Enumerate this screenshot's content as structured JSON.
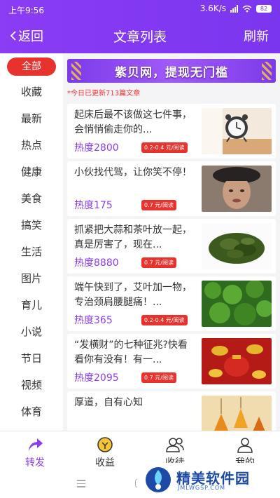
{
  "status_bar": {
    "time": "上午9:56",
    "speed": "3.6K/s",
    "battery": "82"
  },
  "header": {
    "back_label": "返回",
    "title": "文章列表",
    "refresh_label": "刷新"
  },
  "sidebar": {
    "items": [
      {
        "label": "全部",
        "active": true
      },
      {
        "label": "收藏"
      },
      {
        "label": "最新"
      },
      {
        "label": "热点"
      },
      {
        "label": "健康"
      },
      {
        "label": "美食"
      },
      {
        "label": "搞笑"
      },
      {
        "label": "生活"
      },
      {
        "label": "图片"
      },
      {
        "label": "育儿"
      },
      {
        "label": "小说"
      },
      {
        "label": "节日"
      },
      {
        "label": "视频"
      },
      {
        "label": "体育"
      }
    ]
  },
  "banner": {
    "text": "紫贝网，提现无门槛"
  },
  "update_note": "*今日已更新713篇文章",
  "articles": [
    {
      "title": "起床后最不该做这七件事，会悄悄偷走你的...",
      "heat": "热度2800",
      "price": "0.2-0.4 元/阅读",
      "thumb": "clock-image"
    },
    {
      "title": "小伙找代驾，让你笑不停！",
      "heat": "热度175",
      "price": "0.7 元/阅读",
      "thumb": "person-image"
    },
    {
      "title": "抓紧把大蒜和茶叶放一起，真是厉害了，现在...",
      "heat": "热度8880",
      "price": "0.7 元/阅读",
      "thumb": "tea-image"
    },
    {
      "title": "端午快到了，艾叶加一物，专治颈肩腰腿痛！...",
      "heat": "热度365",
      "price": "0.2-0.4 元/阅读",
      "thumb": "mugwort-image"
    },
    {
      "title": "“发横财”的七种征兆?快看看你有没有！有一...",
      "heat": "热度2095",
      "price": "0.7 元/阅读",
      "thumb": "fortune-image"
    },
    {
      "title": "厚道，自有心知",
      "heat": "",
      "price": "",
      "thumb": "leaves-image"
    }
  ],
  "tabs": [
    {
      "label": "转发",
      "icon": "share-icon",
      "active": true
    },
    {
      "label": "收益",
      "icon": "coin-icon"
    },
    {
      "label": "收徒",
      "icon": "users-icon"
    },
    {
      "label": "我的",
      "icon": "user-icon"
    }
  ],
  "watermark": {
    "name": "精美软件园",
    "url": "JMLWGSP.COM"
  },
  "colors": {
    "primary": "#8a3cf5",
    "accent_red": "#e8322d"
  }
}
